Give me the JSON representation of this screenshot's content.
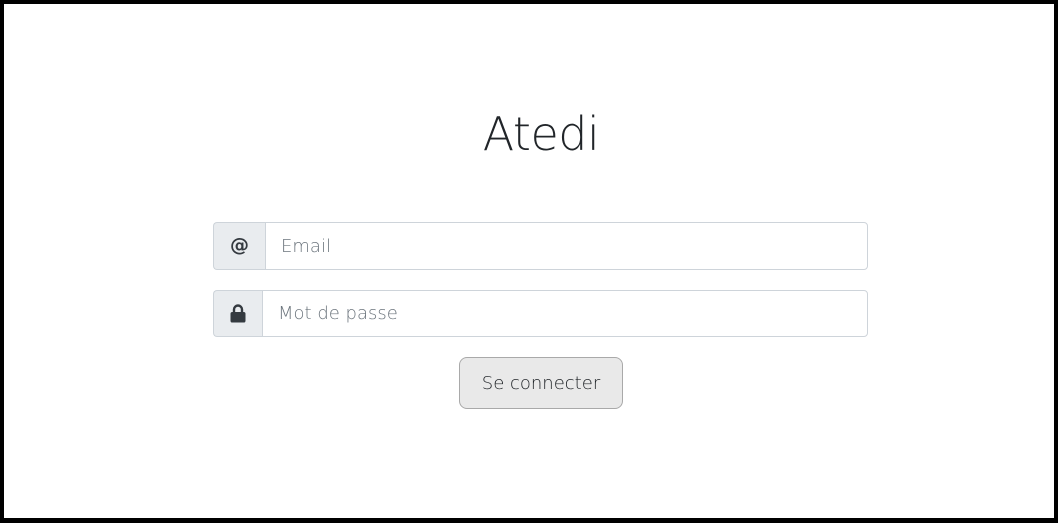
{
  "app": {
    "title": "Atedi"
  },
  "form": {
    "email": {
      "icon": "at-icon",
      "icon_glyph": "@",
      "placeholder": "Email",
      "value": ""
    },
    "password": {
      "icon": "lock-icon",
      "placeholder": "Mot de passe",
      "value": ""
    },
    "submit_label": "Se connecter"
  },
  "colors": {
    "background": "#ffffff",
    "frame_border": "#000000",
    "addon_background": "#e9ecef",
    "input_border": "#ced4da",
    "button_background": "#e9e9e9",
    "button_border": "#a9a9a9",
    "text": "#212529"
  }
}
